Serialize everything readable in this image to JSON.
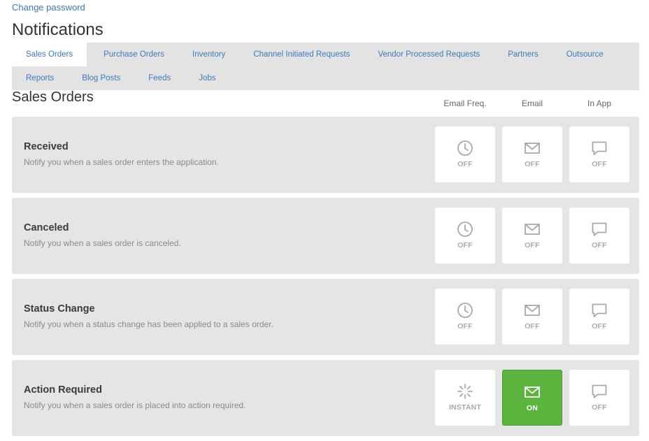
{
  "header": {
    "change_password": "Change password",
    "title": "Notifications"
  },
  "tabs": {
    "row1": [
      "Sales Orders",
      "Purchase Orders",
      "Inventory",
      "Channel Initiated Requests",
      "Vendor Processed Requests",
      "Partners",
      "Outsource"
    ],
    "row2": [
      "Reports",
      "Blog Posts",
      "Feeds",
      "Jobs"
    ],
    "active": "Sales Orders"
  },
  "section": {
    "title": "Sales Orders",
    "columns": [
      "Email Freq.",
      "Email",
      "In App"
    ]
  },
  "colors": {
    "link": "#3b7bbf",
    "on_green": "#5cb33e",
    "card_bg": "#e5e5e5",
    "icon_gray": "#a9a9a9"
  },
  "notifications": [
    {
      "title": "Received",
      "description": "Notify you when a sales order enters the application.",
      "email_freq": {
        "icon": "clock-icon",
        "label": "OFF",
        "on": false
      },
      "email": {
        "icon": "envelope-icon",
        "label": "OFF",
        "on": false
      },
      "in_app": {
        "icon": "chat-bubble-icon",
        "label": "OFF",
        "on": false
      }
    },
    {
      "title": "Canceled",
      "description": "Notify you when a sales order is canceled.",
      "email_freq": {
        "icon": "clock-icon",
        "label": "OFF",
        "on": false
      },
      "email": {
        "icon": "envelope-icon",
        "label": "OFF",
        "on": false
      },
      "in_app": {
        "icon": "chat-bubble-icon",
        "label": "OFF",
        "on": false
      }
    },
    {
      "title": "Status Change",
      "description": "Notify you when a status change has been applied to a sales order.",
      "email_freq": {
        "icon": "clock-icon",
        "label": "OFF",
        "on": false
      },
      "email": {
        "icon": "envelope-icon",
        "label": "OFF",
        "on": false
      },
      "in_app": {
        "icon": "chat-bubble-icon",
        "label": "OFF",
        "on": false
      }
    },
    {
      "title": "Action Required",
      "description": "Notify you when a sales order is placed into action required.",
      "email_freq": {
        "icon": "spinner-icon",
        "label": "INSTANT",
        "on": false
      },
      "email": {
        "icon": "envelope-icon",
        "label": "ON",
        "on": true
      },
      "in_app": {
        "icon": "chat-bubble-icon",
        "label": "OFF",
        "on": false
      }
    }
  ]
}
